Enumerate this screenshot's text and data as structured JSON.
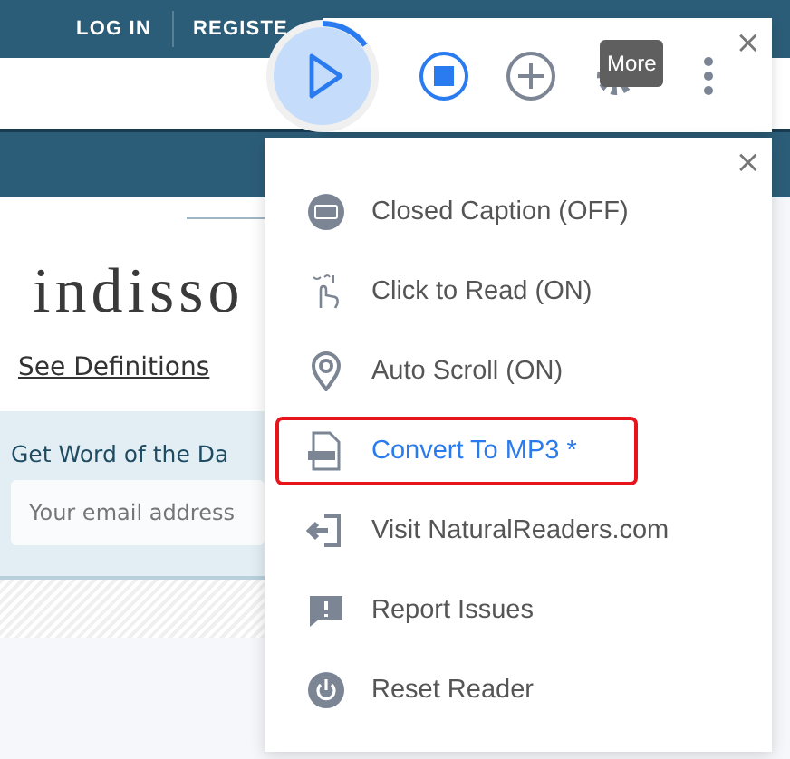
{
  "site": {
    "nav": [
      "LOG IN",
      "REGISTE"
    ],
    "word": "indisso",
    "definitions_link": "See Definitions",
    "newsletter": {
      "title": "Get Word of the Da",
      "placeholder": "Your email address"
    }
  },
  "player": {
    "level": 0.15,
    "tooltip": "More",
    "close": "×"
  },
  "menu": {
    "close": "×",
    "items": [
      {
        "kind": "caption",
        "label": "Closed Caption (OFF)",
        "selected": false
      },
      {
        "kind": "click",
        "label": "Click to Read (ON)",
        "selected": false
      },
      {
        "kind": "scroll",
        "label": "Auto Scroll (ON)",
        "selected": false
      },
      {
        "kind": "mp3",
        "label": "Convert To MP3 *",
        "selected": true
      },
      {
        "kind": "visit",
        "label": "Visit NaturalReaders.com",
        "selected": false
      },
      {
        "kind": "report",
        "label": "Report Issues",
        "selected": false
      },
      {
        "kind": "reset",
        "label": "Reset Reader",
        "selected": false
      }
    ]
  }
}
